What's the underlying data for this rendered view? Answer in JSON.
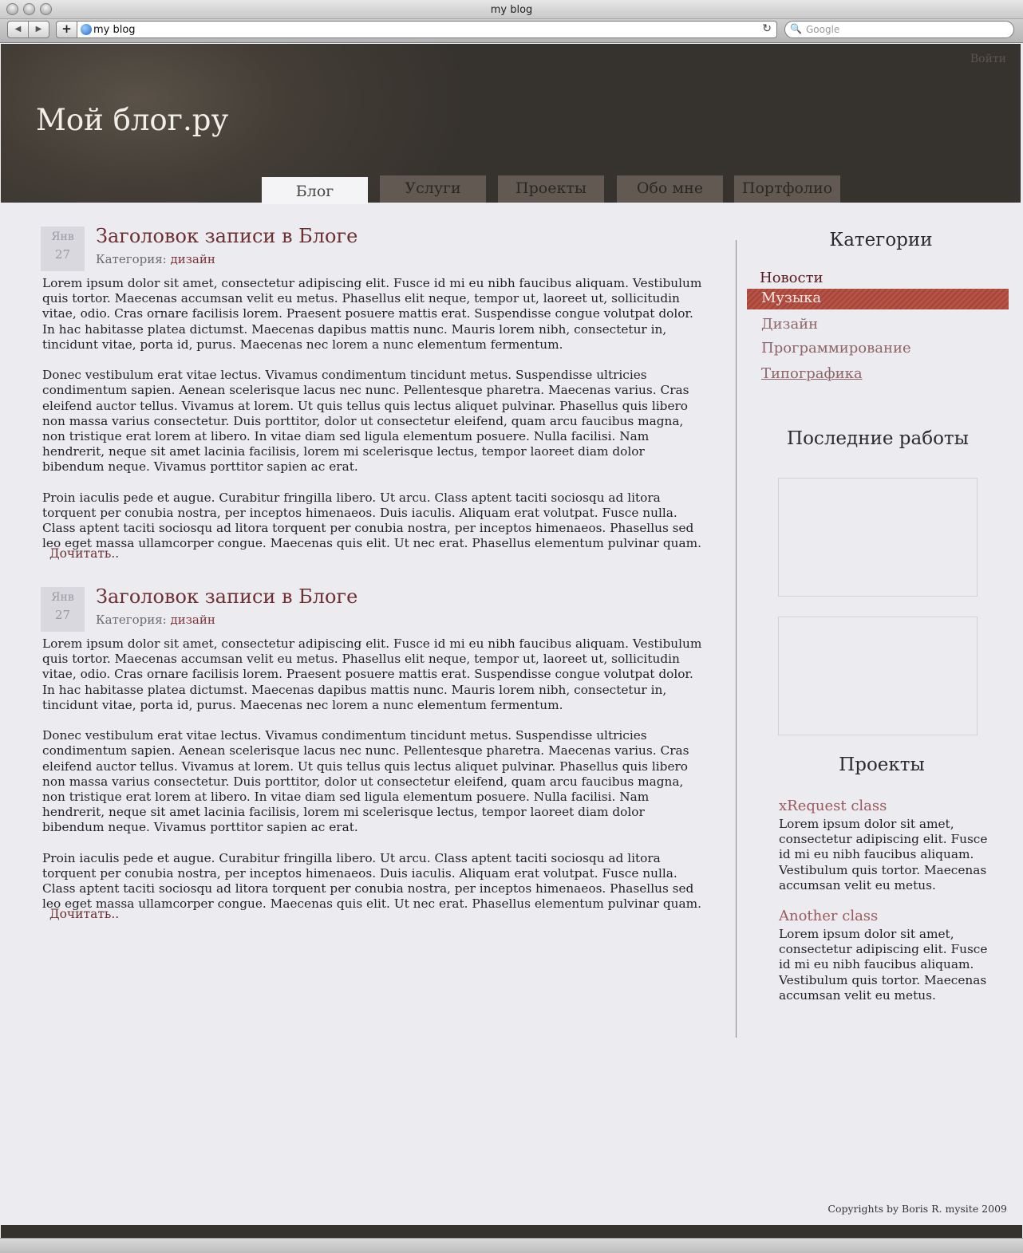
{
  "browser": {
    "window_title": "my blog",
    "url": "my blog",
    "search_placeholder": "Google",
    "back": "◀",
    "forward": "▶",
    "add": "+",
    "reload": "↻",
    "search_glyph": "🔍"
  },
  "header": {
    "login": "Войти",
    "site_title": "Мой блог.ру",
    "tabs": [
      {
        "label": "Блог",
        "active": true
      },
      {
        "label": "Услуги",
        "active": false
      },
      {
        "label": "Проекты",
        "active": false
      },
      {
        "label": "Обо мне",
        "active": false
      },
      {
        "label": "Портфолио",
        "active": false
      }
    ]
  },
  "posts": [
    {
      "month": "Янв",
      "day": "27",
      "title": "Заголовок записи в Блоге",
      "category_prefix": "Категория:",
      "category": "дизайн",
      "paragraphs": [
        "Lorem ipsum dolor sit amet, consectetur adipiscing elit. Fusce id mi eu nibh faucibus aliquam. Vestibulum quis tortor. Maecenas accumsan velit eu metus. Phasellus elit neque, tempor ut, laoreet ut, sollicitudin vitae, odio. Cras ornare facilisis lorem. Praesent posuere mattis erat. Suspendisse congue volutpat dolor. In hac habitasse platea dictumst. Maecenas dapibus mattis nunc. Mauris lorem nibh, consectetur in, tincidunt vitae, porta id, purus. Maecenas nec lorem a nunc elementum fermentum.",
        "Donec vestibulum erat vitae lectus. Vivamus condimentum tincidunt metus. Suspendisse ultricies condimentum sapien. Aenean scelerisque lacus nec nunc. Pellentesque pharetra. Maecenas varius. Cras eleifend auctor tellus. Vivamus at lorem. Ut quis tellus quis lectus aliquet pulvinar. Phasellus quis libero non massa varius consectetur. Duis porttitor, dolor ut consectetur eleifend, quam arcu faucibus magna, non tristique erat lorem at libero. In vitae diam sed ligula elementum posuere. Nulla facilisi. Nam hendrerit, neque sit amet lacinia facilisis, lorem mi scelerisque lectus, tempor laoreet diam dolor bibendum neque. Vivamus porttitor sapien ac erat.",
        "Proin iaculis pede et augue. Curabitur fringilla libero. Ut arcu. Class aptent taciti sociosqu ad litora torquent per conubia nostra, per inceptos himenaeos. Duis iaculis. Aliquam erat volutpat. Fusce nulla. Class aptent taciti sociosqu ad litora torquent per conubia nostra, per inceptos himenaeos. Phasellus sed leo eget massa ullamcorper congue. Maecenas quis elit. Ut nec erat. Phasellus elementum pulvinar quam."
      ],
      "read_more": "Дочитать.."
    },
    {
      "month": "Янв",
      "day": "27",
      "title": "Заголовок записи в Блоге",
      "category_prefix": "Категория:",
      "category": "дизайн",
      "paragraphs": [
        "Lorem ipsum dolor sit amet, consectetur adipiscing elit. Fusce id mi eu nibh faucibus aliquam. Vestibulum quis tortor. Maecenas accumsan velit eu metus. Phasellus elit neque, tempor ut, laoreet ut, sollicitudin vitae, odio. Cras ornare facilisis lorem. Praesent posuere mattis erat. Suspendisse congue volutpat dolor. In hac habitasse platea dictumst. Maecenas dapibus mattis nunc. Mauris lorem nibh, consectetur in, tincidunt vitae, porta id, purus. Maecenas nec lorem a nunc elementum fermentum.",
        "Donec vestibulum erat vitae lectus. Vivamus condimentum tincidunt metus. Suspendisse ultricies condimentum sapien. Aenean scelerisque lacus nec nunc. Pellentesque pharetra. Maecenas varius. Cras eleifend auctor tellus. Vivamus at lorem. Ut quis tellus quis lectus aliquet pulvinar. Phasellus quis libero non massa varius consectetur. Duis porttitor, dolor ut consectetur eleifend, quam arcu faucibus magna, non tristique erat lorem at libero. In vitae diam sed ligula elementum posuere. Nulla facilisi. Nam hendrerit, neque sit amet lacinia facilisis, lorem mi scelerisque lectus, tempor laoreet diam dolor bibendum neque. Vivamus porttitor sapien ac erat.",
        "Proin iaculis pede et augue. Curabitur fringilla libero. Ut arcu. Class aptent taciti sociosqu ad litora torquent per conubia nostra, per inceptos himenaeos. Duis iaculis. Aliquam erat volutpat. Fusce nulla. Class aptent taciti sociosqu ad litora torquent per conubia nostra, per inceptos himenaeos. Phasellus sed leo eget massa ullamcorper congue. Maecenas quis elit. Ut nec erat. Phasellus elementum pulvinar quam."
      ],
      "read_more": "Дочитать.."
    }
  ],
  "sidebar": {
    "categories_heading": "Категории",
    "categories": [
      {
        "label": "Новости"
      },
      {
        "label": "Музыка",
        "active": true
      },
      {
        "label": "Дизайн"
      },
      {
        "label": "Программирование"
      },
      {
        "label": "Типографика",
        "underlined": true
      }
    ],
    "works_heading": "Последние работы",
    "projects_heading": "Проекты",
    "projects": [
      {
        "name": "xRequest class",
        "description": "Lorem ipsum dolor sit amet, consectetur adipiscing elit. Fusce id mi eu nibh faucibus aliquam. Vestibulum quis tortor. Maecenas accumsan velit eu metus."
      },
      {
        "name": "Another class",
        "description": "Lorem ipsum dolor sit amet, consectetur adipiscing elit. Fusce id mi eu nibh faucibus aliquam. Vestibulum quis tortor. Maecenas accumsan velit eu metus."
      }
    ]
  },
  "footer": {
    "copyright": "Copyrights by Boris R. mysite 2009"
  },
  "colors": {
    "header_bg": "#36322d",
    "tab_bg": "#625a52",
    "accent": "#6c2f33",
    "category_active": "#b85246",
    "page_bg": "#ececf0"
  }
}
